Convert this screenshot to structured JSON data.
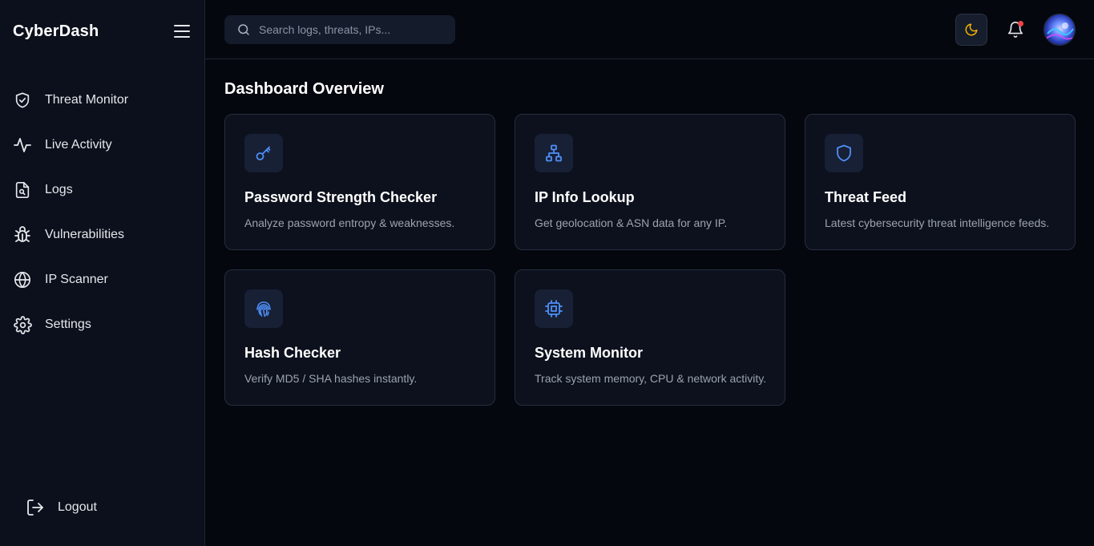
{
  "app": {
    "brand": "CyberDash"
  },
  "sidebar": {
    "items": [
      {
        "label": "Threat Monitor",
        "icon": "shield-check-icon"
      },
      {
        "label": "Live Activity",
        "icon": "activity-icon"
      },
      {
        "label": "Logs",
        "icon": "file-search-icon"
      },
      {
        "label": "Vulnerabilities",
        "icon": "bug-icon"
      },
      {
        "label": "IP Scanner",
        "icon": "globe-icon"
      },
      {
        "label": "Settings",
        "icon": "gear-icon"
      }
    ],
    "logout_label": "Logout"
  },
  "header": {
    "search_placeholder": "Search logs, threats, IPs...",
    "notification_indicator": true
  },
  "main": {
    "title": "Dashboard Overview",
    "cards": [
      {
        "title": "Password Strength Checker",
        "description": "Analyze password entropy & weaknesses.",
        "icon": "key-icon"
      },
      {
        "title": "IP Info Lookup",
        "description": "Get geolocation & ASN data for any IP.",
        "icon": "network-icon"
      },
      {
        "title": "Threat Feed",
        "description": "Latest cybersecurity threat intelligence feeds.",
        "icon": "shield-icon"
      },
      {
        "title": "Hash Checker",
        "description": "Verify MD5 / SHA hashes instantly.",
        "icon": "fingerprint-icon"
      },
      {
        "title": "System Monitor",
        "description": "Track system memory, CPU & network activity.",
        "icon": "cpu-icon"
      }
    ]
  },
  "colors": {
    "background": "#05070f",
    "sidebar": "#0b101c",
    "card": "#0c111d",
    "accent": "#3b82f6",
    "moon": "#f5b300",
    "notification": "#ef4444"
  }
}
